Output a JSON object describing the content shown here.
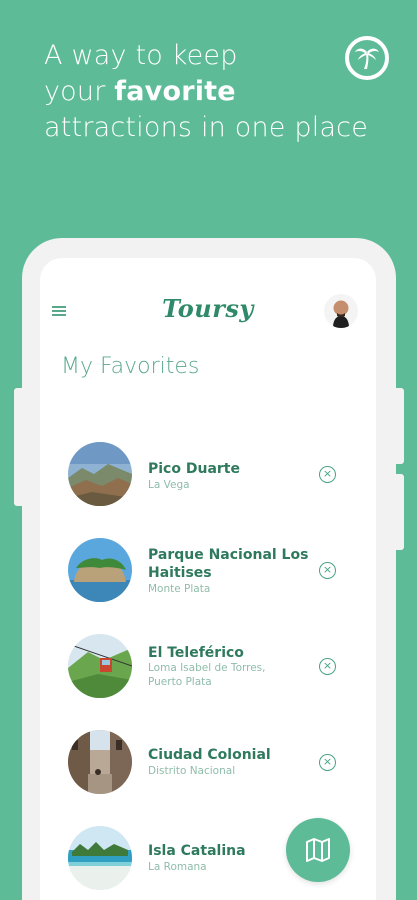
{
  "promo": {
    "line1": "A way to keep",
    "line2_prefix": "your ",
    "line2_bold": "favorite",
    "line3": "attractions in one place"
  },
  "app": {
    "logo": "Toursy",
    "page_title": "My Favorites"
  },
  "icons": {
    "brand": "palm-tree-icon",
    "menu": "hamburger-menu-icon",
    "remove": "close-circle-icon",
    "map": "map-icon"
  },
  "colors": {
    "background": "#5dbb98",
    "accent": "#2f7a5e",
    "muted": "#8fbcab"
  },
  "favorites": [
    {
      "name": "Pico Duarte",
      "location": "La Vega"
    },
    {
      "name": "Parque Nacional Los Haitises",
      "location": "Monte Plata"
    },
    {
      "name": "El Teleférico",
      "location": "Loma Isabel de Torres, Puerto Plata"
    },
    {
      "name": "Ciudad Colonial",
      "location": "Distrito Nacional"
    },
    {
      "name": "Isla Catalina",
      "location": "La Romana"
    }
  ]
}
